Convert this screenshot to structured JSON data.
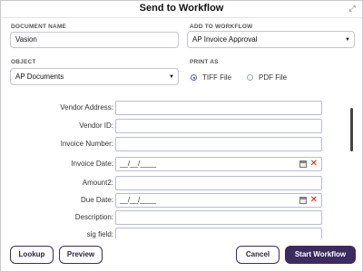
{
  "dialog": {
    "title": "Send to Workflow",
    "expand_icon": "expand-arrows-icon"
  },
  "document_name": {
    "label": "DOCUMENT NAME",
    "value": "Vasion"
  },
  "add_to_workflow": {
    "label": "ADD TO WORKFLOW",
    "selected": "AP Invoice Approval"
  },
  "object": {
    "label": "OBJECT",
    "selected": "AP Documents"
  },
  "print_as": {
    "label": "PRINT AS",
    "options": [
      "TIFF File",
      "PDF File"
    ],
    "selected": "TIFF File"
  },
  "form": {
    "fields": [
      {
        "label": "Vendor Address:",
        "value": ""
      },
      {
        "label": "Vendor ID:",
        "value": ""
      },
      {
        "label": "Invoice Number:",
        "value": ""
      },
      {
        "label": "Invoice Date:",
        "value": "__/__/____"
      },
      {
        "label": "Amount2:",
        "value": ""
      },
      {
        "label": "Due Date:",
        "value": "__/__/____"
      },
      {
        "label": "Description:",
        "value": ""
      },
      {
        "label": "sig field:",
        "value": ""
      }
    ]
  },
  "buttons": {
    "lookup": "Lookup",
    "preview": "Preview",
    "cancel": "Cancel",
    "start": "Start Workflow"
  },
  "colors": {
    "primary": "#3b2b5e",
    "clear_icon": "#dd1111"
  }
}
